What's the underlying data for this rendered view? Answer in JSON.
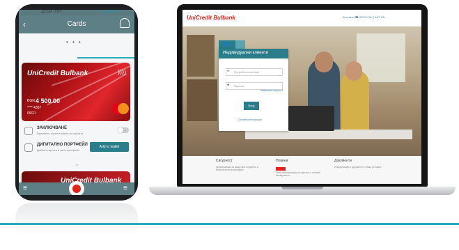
{
  "phone": {
    "header_title": "Cards",
    "back_glyph": "‹",
    "pager_dots": "• • •",
    "tabs": [
      "ДЕБИТНИ",
      "КРЕДИТНИ"
    ],
    "card": {
      "brand": "UniCredit Bulbank",
      "amount_label": "BGN",
      "amount": "4 500.00",
      "number": "**** 4367",
      "expiry": "09/21",
      "nfc_glyph": "))))"
    },
    "rows": [
      {
        "title": "ЗАКЛЮЧВАНЕ",
        "subtitle": "Временно ограничаване на картата"
      },
      {
        "title": "ДИГИТАЛНО ПОРТФЕЙЛ",
        "subtitle": "Добави картата в своя портфейл",
        "button": "Add to wallet"
      }
    ],
    "chevron": "⌄",
    "card2_brand": "UniCredit Bulbank",
    "menu_glyph": "≡"
  },
  "site": {
    "logo": "UniCredit Bulbank",
    "header_links": "Контакти  ☎ 0700 1 84  ▯ 24/7  EN",
    "login": {
      "tab_icon": "👤",
      "title": "Индивидуални клиенти",
      "username_placeholder": "Потребителско име",
      "password_placeholder": "Парола",
      "forgot": "Забравена парола?",
      "button": "Вход",
      "register": "Онлайн регистрация"
    },
    "sections": [
      {
        "title": "Сигурност",
        "text": "Информация за защитата на данни и безопасното използване"
      },
      {
        "title": "Новини",
        "text": "Нова информация за картите и онлайн банкирането"
      },
      {
        "title": "Документи",
        "text": "Информация и документи, общи условия"
      }
    ],
    "accent": "#2a7d8b",
    "brand_red": "#e2231a"
  }
}
